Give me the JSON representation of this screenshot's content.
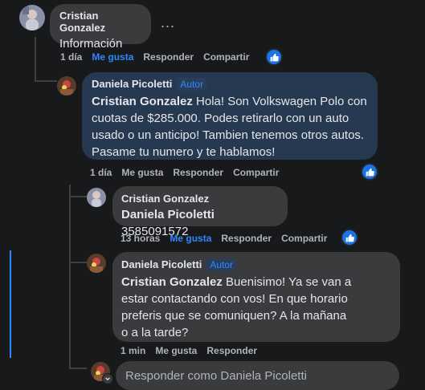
{
  "comment_top": {
    "author": "Cristian Gonzalez",
    "text": "Información",
    "actions": {
      "time": "1 día",
      "like": "Me gusta",
      "reply": "Responder",
      "share": "Compartir"
    },
    "more_label": "..."
  },
  "reply_1": {
    "author": "Daniela Picoletti",
    "badge": "Autor",
    "mention": "Cristian Gonzalez",
    "text": " Hola! Son Volkswagen Polo con cuotas de $285.000. Podes retirarlo con un auto usado o un anticipo! Tambien tenemos otros autos. Pasame tu numero y te hablamos!",
    "actions": {
      "time": "1 día",
      "like": "Me gusta",
      "reply": "Responder",
      "share": "Compartir"
    }
  },
  "reply_2": {
    "author": "Cristian Gonzalez",
    "mention": "Daniela Picoletti",
    "text": " 3585091572",
    "actions": {
      "time": "13 horas",
      "like": "Me gusta",
      "reply": "Responder",
      "share": "Compartir"
    }
  },
  "reply_3": {
    "author": "Daniela Picoletti",
    "badge": "Autor",
    "mention": "Cristian Gonzalez",
    "text": " Buenisimo! Ya se van a estar contactando con vos! En que horario preferis que se comuniquen? A la mañana o a la tarde?",
    "actions": {
      "time": "1 min",
      "like": "Me gusta",
      "reply": "Responder"
    }
  },
  "reply_input": {
    "placeholder": "Responder como Daniela Picoletti"
  },
  "colors": {
    "background": "#18191a",
    "bubble": "#3a3b3c",
    "highlight_bubble": "#263951",
    "accent": "#2d88ff"
  },
  "icons": [
    "like-icon",
    "avatar-cristian",
    "avatar-daniela",
    "chevron-down-icon",
    "more-icon"
  ]
}
